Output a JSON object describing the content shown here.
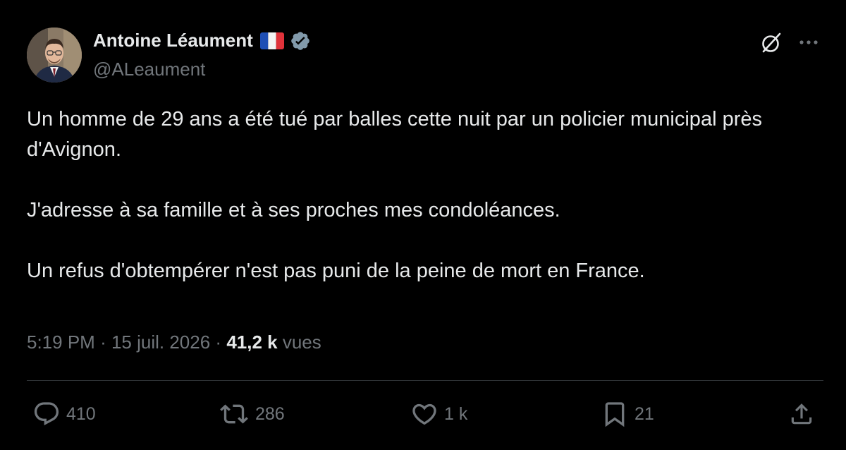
{
  "author": {
    "name": "Antoine Léaument",
    "handle": "@ALeaument",
    "flag": "french-flag-icon",
    "verified": true
  },
  "tweet": {
    "paragraphs": [
      "Un homme de 29 ans a été tué par balles cette nuit par un policier municipal près d'Avignon.",
      "J'adresse à sa famille et à ses proches mes condoléances.",
      "Un refus d'obtempérer n'est pas puni de la peine de mort en France."
    ]
  },
  "meta": {
    "time": "5:19 PM",
    "separator": "·",
    "date": "15 juil. 2026",
    "views_count": "41,2 k",
    "views_label": "vues"
  },
  "actions": {
    "replies": "410",
    "reposts": "286",
    "likes": "1 k",
    "bookmarks": "21"
  },
  "colors": {
    "background": "#000000",
    "text": "#e7e9ea",
    "secondary": "#71767b",
    "divider": "#2f3336",
    "verified": "#829aab"
  }
}
